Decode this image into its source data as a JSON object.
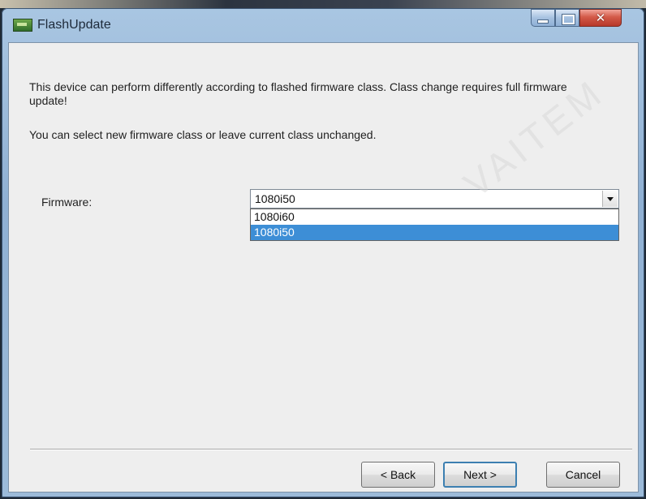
{
  "window": {
    "title": "FlashUpdate",
    "app_icon": "flash-update-icon",
    "controls": {
      "minimize": "minimize-icon",
      "maximize": "maximize-icon",
      "close_glyph": "✕"
    }
  },
  "main": {
    "description_1": "This device can perform differently according to flashed firmware class. Class change requires full firmware update!",
    "description_2": "You can select new firmware class or leave current class unchanged.",
    "firmware": {
      "label": "Firmware:",
      "selected": "1080i50",
      "options": [
        "1080i60",
        "1080i50"
      ],
      "highlighted_index": 1
    }
  },
  "footer": {
    "back_label": "< Back",
    "next_label": "Next >",
    "cancel_label": "Cancel"
  },
  "watermark": "VAITEM",
  "colors": {
    "selection": "#3d8ed6",
    "dialog_bg": "#eeeeee",
    "close_button": "#c8463a",
    "default_button_border": "#3c7fb1"
  }
}
